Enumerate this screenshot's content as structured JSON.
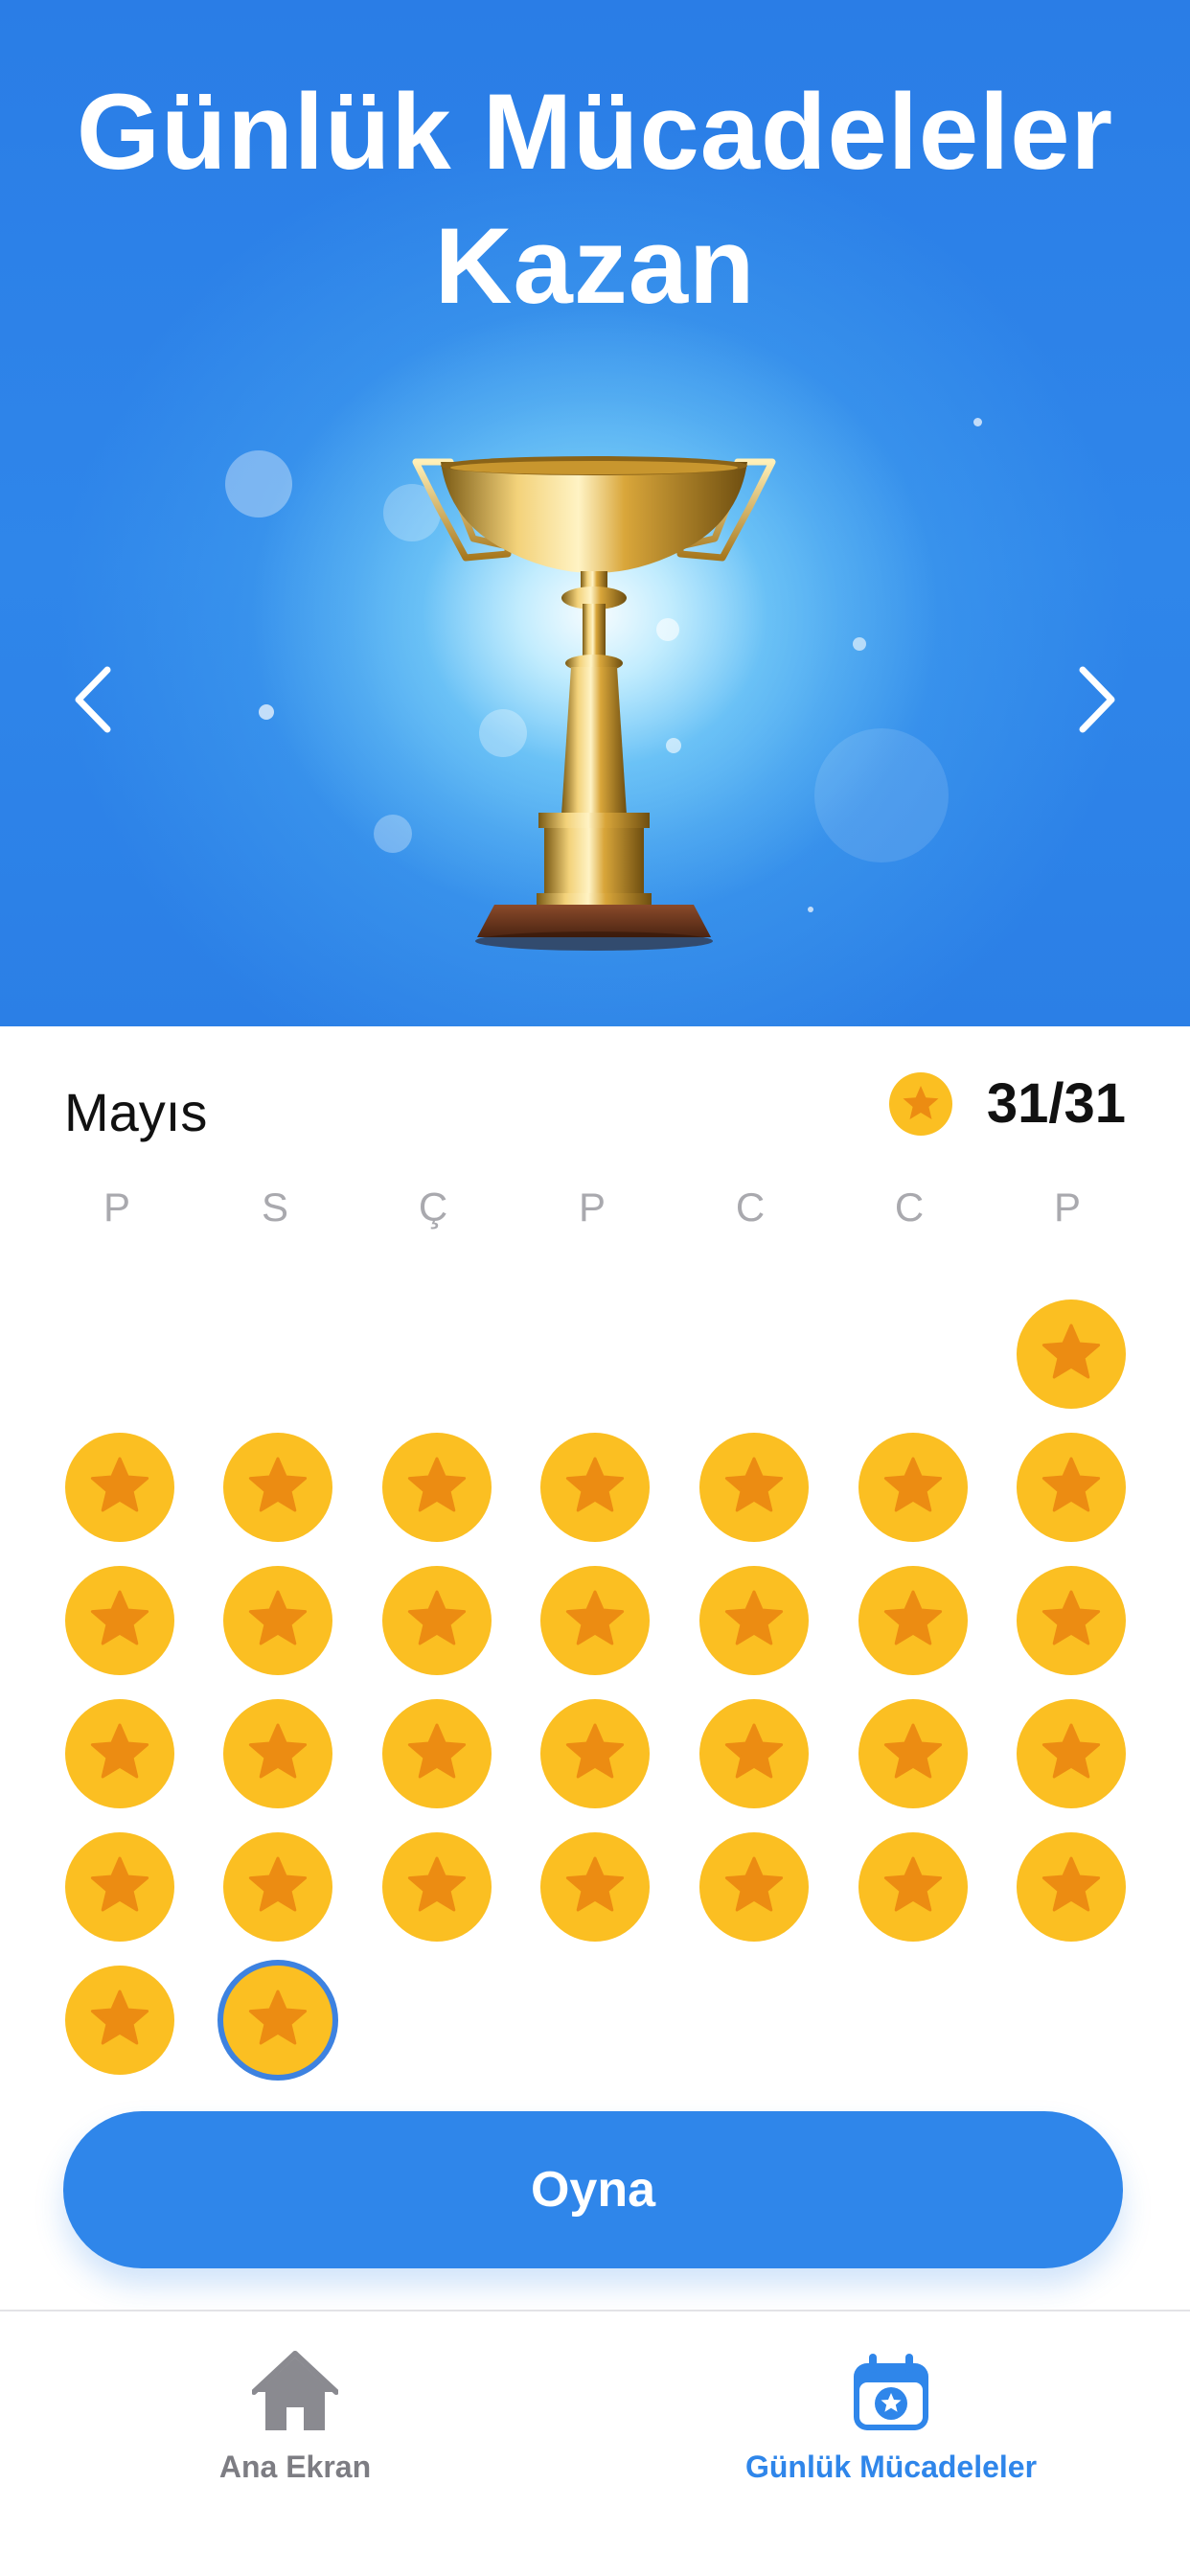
{
  "hero": {
    "title_line1": "Günlük Mücadeleler",
    "title_line2": "Kazan"
  },
  "calendar": {
    "month": "Mayıs",
    "score": "31/31",
    "weekdays": [
      "P",
      "S",
      "Ç",
      "P",
      "C",
      "C",
      "P"
    ],
    "days_completed": 31,
    "today_day": 31
  },
  "play_button": {
    "label": "Oyna"
  },
  "tabbar": {
    "items": [
      {
        "label": "Ana Ekran",
        "icon": "home-icon",
        "active": false
      },
      {
        "label": "Günlük Mücadeleler",
        "icon": "calendar-star-icon",
        "active": true
      }
    ]
  },
  "colors": {
    "accent": "#2f86ea",
    "coin": "#fbbf22",
    "star": "#ec8c12",
    "inactive_tab": "#7d7d83",
    "weekday": "#a9a9ae"
  }
}
